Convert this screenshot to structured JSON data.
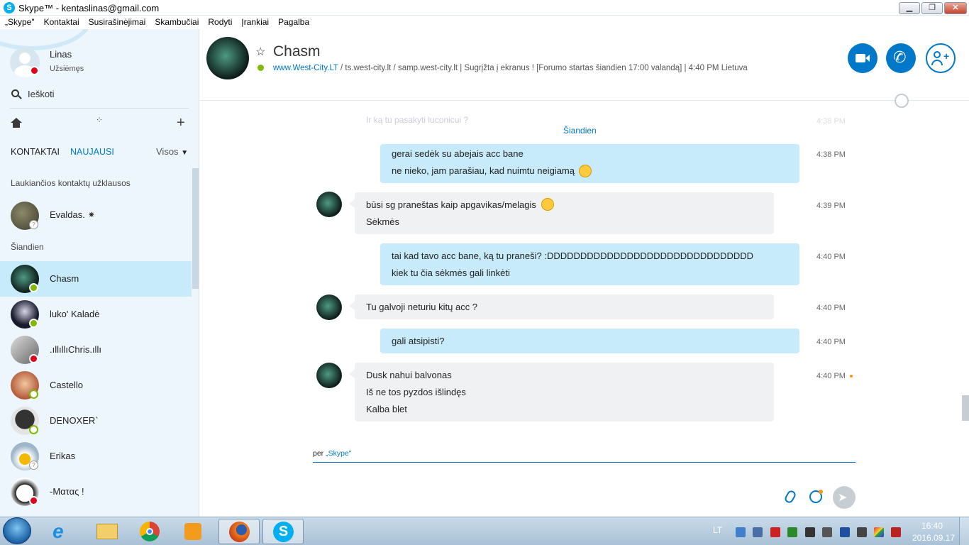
{
  "window": {
    "title": "Skype™ - kentaslinas@gmail.com",
    "menu": [
      "„Skype\"",
      "Kontaktai",
      "Susirašinėjimai",
      "Skambučiai",
      "Rodyti",
      "Įrankiai",
      "Pagalba"
    ]
  },
  "profile": {
    "name": "Linas",
    "status": "Užsiėmęs"
  },
  "search": {
    "placeholder": "Ieškoti"
  },
  "tabs": {
    "contacts": "KONTAKTAI",
    "recent": "NAUJAUSI",
    "filter": "Visos"
  },
  "sections": {
    "pending": "Laukiančios kontaktų užklausos",
    "today": "Šiandien"
  },
  "pending_contacts": [
    {
      "name": "Evaldas. ⁕"
    }
  ],
  "contacts": [
    {
      "name": "Chasm"
    },
    {
      "name": "luko' Kaladė"
    },
    {
      "name": ".ıllıllıChris.ıllı"
    },
    {
      "name": "Castello"
    },
    {
      "name": "DENOXER`"
    },
    {
      "name": "Erikas"
    },
    {
      "name": "-Ματας !"
    }
  ],
  "chat": {
    "name": "Chasm",
    "mood_link": "www.West-City.LT",
    "mood_text": "/ ts.west-city.lt / samp.west-city.lt | Sugrįžta į ekranus ! [Forumo startas šiandien 17:00 valandą]",
    "local_time": "| 4:40 PM Lietuva",
    "faded_msg": "Ir ką tu pasakyti luconicui ?",
    "faded_time": "4:38 PM",
    "date_divider": "Šiandien",
    "messages": [
      {
        "lines": [
          "gerai sedėk su abejais acc bane",
          "ne nieko, jam parašiau, kad nuimtu neigiamą"
        ],
        "time": "4:38 PM"
      },
      {
        "lines": [
          "būsi sg praneštas kaip apgavikas/melagis",
          "Sėkmės"
        ],
        "time": "4:39 PM"
      },
      {
        "lines": [
          "tai kad tavo acc bane, ką tu praneši? :DDDDDDDDDDDDDDDDDDDDDDDDDDDDDDD",
          "kiek tu čia sėkmės gali linkėti"
        ],
        "time": "4:40 PM"
      },
      {
        "lines": [
          "Tu galvoji neturiu kitų acc ?"
        ],
        "time": "4:40 PM"
      },
      {
        "lines": [
          "gali atsipisti?"
        ],
        "time": "4:40 PM"
      },
      {
        "lines": [
          "Dusk nahui balvonas",
          "Iš ne tos pyzdos išlindęs",
          "Kalba blet"
        ],
        "time": "4:40 PM"
      }
    ],
    "input_via": "per",
    "input_via_link": "„Skype\""
  },
  "taskbar": {
    "lang": "LT",
    "time": "16:40",
    "date": "2016.09.17"
  },
  "colors": {
    "accent": "#0078ca",
    "outgoing": "#c7ebfb",
    "incoming": "#eff1f3",
    "busy": "#e2001a",
    "online": "#7fba00"
  }
}
